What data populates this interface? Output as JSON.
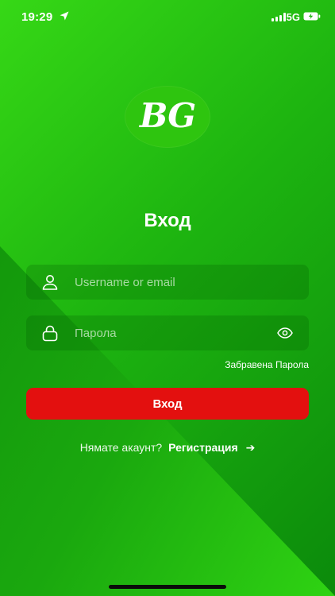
{
  "status_bar": {
    "time": "19:29",
    "network": "5G",
    "location_icon": "location-arrow-icon",
    "signal_icon": "cellular-signal-icon",
    "battery_icon": "battery-charging-icon"
  },
  "logo": {
    "text": "BG"
  },
  "login": {
    "title": "Вход",
    "username_placeholder": "Username or email",
    "password_placeholder": "Парола",
    "forgot_label": "Забравена Парола",
    "submit_label": "Вход"
  },
  "register": {
    "question": "Нямате акаунт?",
    "link_label": "Регистрация",
    "arrow": "➔"
  },
  "colors": {
    "primary_green": "#1fc80a",
    "dark_green": "#0b8a0b",
    "button_red": "#e3100f",
    "logo_green": "#2ec50f"
  }
}
